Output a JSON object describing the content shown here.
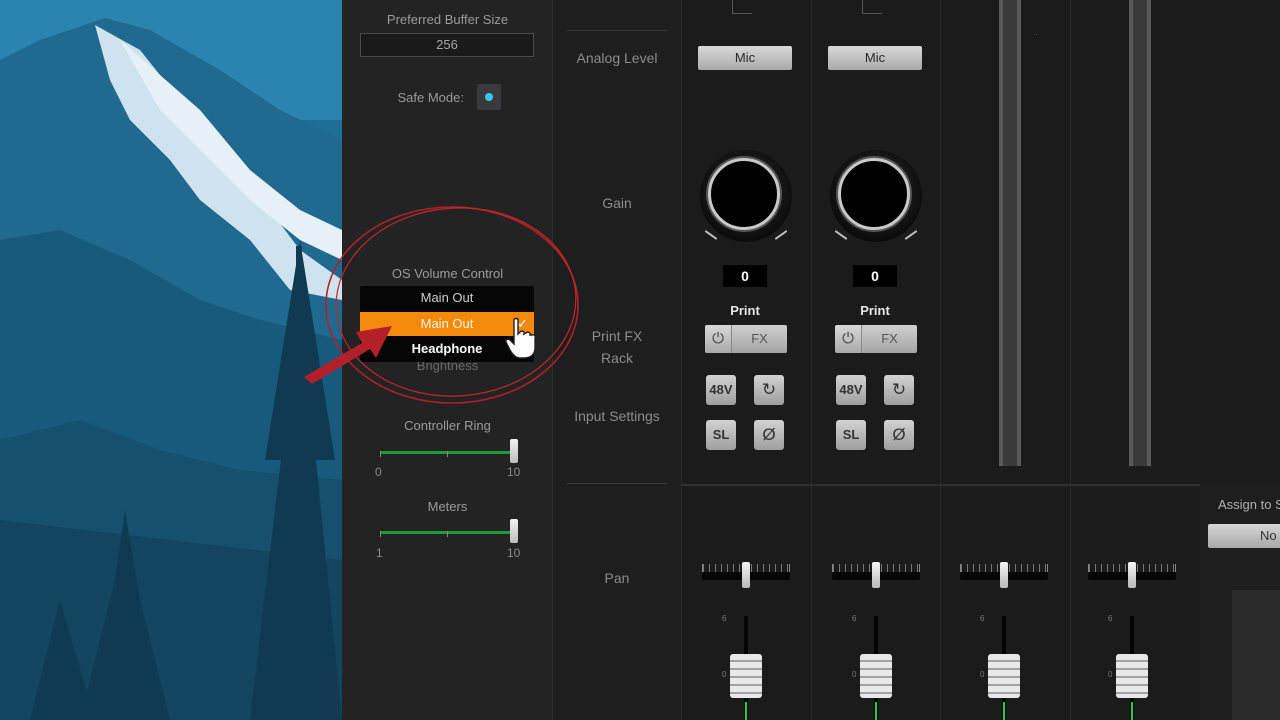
{
  "settings": {
    "buffer_label": "Preferred Buffer Size",
    "buffer_value": "256",
    "safe_mode_label": "Safe Mode:",
    "os_volume_label": "OS Volume Control",
    "os_volume_options": [
      "Main Out",
      "Main Out",
      "Headphone"
    ],
    "brightness_label": "Brightness",
    "controller_ring_label": "Controller Ring",
    "controller_ring_min": "0",
    "controller_ring_max": "10",
    "controller_ring_value": 1.0,
    "meters_label": "Meters",
    "meters_min": "1",
    "meters_max": "10",
    "meters_value": 1.0,
    "accent_color": "#f38a0c",
    "safe_mode_color": "#3bc6f2"
  },
  "labels": {
    "analog_level": "Analog Level",
    "gain": "Gain",
    "print_fx_rack_line1": "Print FX",
    "print_fx_rack_line2": "Rack",
    "input_settings": "Input Settings",
    "pan": "Pan"
  },
  "channels": [
    {
      "level_button": "Mic",
      "gain_value": "0",
      "print_label": "Print",
      "fx_label": "FX",
      "btn_48v": "48V",
      "btn_sl": "SL",
      "btn_phase": "Ø",
      "pan_value": 0.5
    },
    {
      "level_button": "Mic",
      "gain_value": "0",
      "print_label": "Print",
      "fx_label": "FX",
      "btn_48v": "48V",
      "btn_sl": "SL",
      "btn_phase": "Ø",
      "pan_value": 0.5
    }
  ],
  "output_pans": [
    0.5,
    0.5
  ],
  "fader_scale": [
    "6",
    "0"
  ],
  "assign": {
    "label": "Assign to S",
    "button": "No"
  },
  "icons": {
    "power": "power-icon",
    "input_settings_rotate": "rotate-icon",
    "phase": "phase-icon",
    "cursor": "pointer-hand-icon",
    "checkmark": "check-icon"
  }
}
